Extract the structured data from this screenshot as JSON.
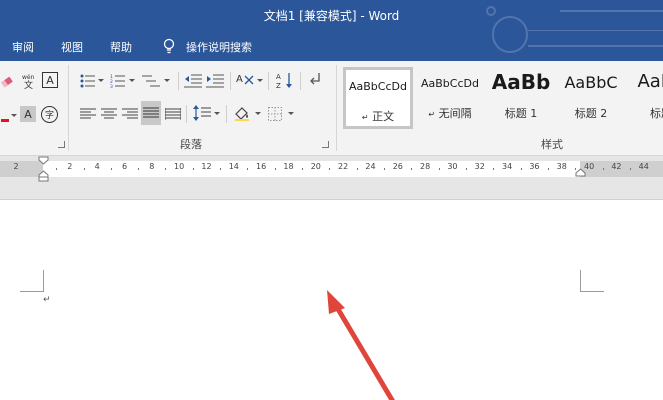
{
  "window": {
    "title": "文档1 [兼容模式] - Word",
    "theme_color": "#2b579a"
  },
  "tabs": [
    {
      "label": "审阅"
    },
    {
      "label": "视图"
    },
    {
      "label": "帮助"
    }
  ],
  "tell_me": {
    "icon": "lightbulb-icon",
    "label": "操作说明搜索"
  },
  "ribbon": {
    "font_group": {
      "icons": [
        "eraser-icon",
        "phonetic-guide-icon",
        "character-border-icon",
        "highlight-icon",
        "character-shading-icon",
        "enclose-characters-icon"
      ],
      "buttons": {
        "character_border": "A",
        "character_shading": "A",
        "enclose": "字"
      }
    },
    "paragraph_group": {
      "label": "段落",
      "icons": [
        "bullets-icon",
        "numbering-icon",
        "multilevel-list-icon",
        "decrease-indent-icon",
        "increase-indent-icon",
        "chinese-layout-icon",
        "sort-icon",
        "show-marks-icon",
        "align-left-icon",
        "center-icon",
        "align-right-icon",
        "justify-icon",
        "distributed-icon",
        "line-spacing-icon",
        "shading-icon",
        "borders-icon"
      ]
    },
    "styles_group": {
      "label": "样式",
      "items": [
        {
          "sample": "AaBbCcDd",
          "name": "正文",
          "selected": true,
          "prefix": "↵"
        },
        {
          "sample": "AaBbCcDd",
          "name": "无间隔",
          "selected": false,
          "prefix": "↵"
        },
        {
          "sample": "AaBb",
          "name": "标题 1",
          "selected": false,
          "prefix": ""
        },
        {
          "sample": "AaBbC",
          "name": "标题 2",
          "selected": false,
          "prefix": ""
        },
        {
          "sample": "AaBb",
          "name": "标题",
          "selected": false,
          "prefix": ""
        }
      ]
    }
  },
  "ruler": {
    "ticks": [
      "2",
      "2",
      "4",
      "6",
      "8",
      "10",
      "12",
      "14",
      "16",
      "18",
      "20",
      "22",
      "24",
      "26",
      "28",
      "30",
      "32",
      "34",
      "36",
      "38",
      "40",
      "42",
      "44"
    ]
  },
  "document": {
    "paragraph_mark": "↵",
    "annotation": {
      "type": "arrow",
      "color": "#e0453b"
    }
  }
}
